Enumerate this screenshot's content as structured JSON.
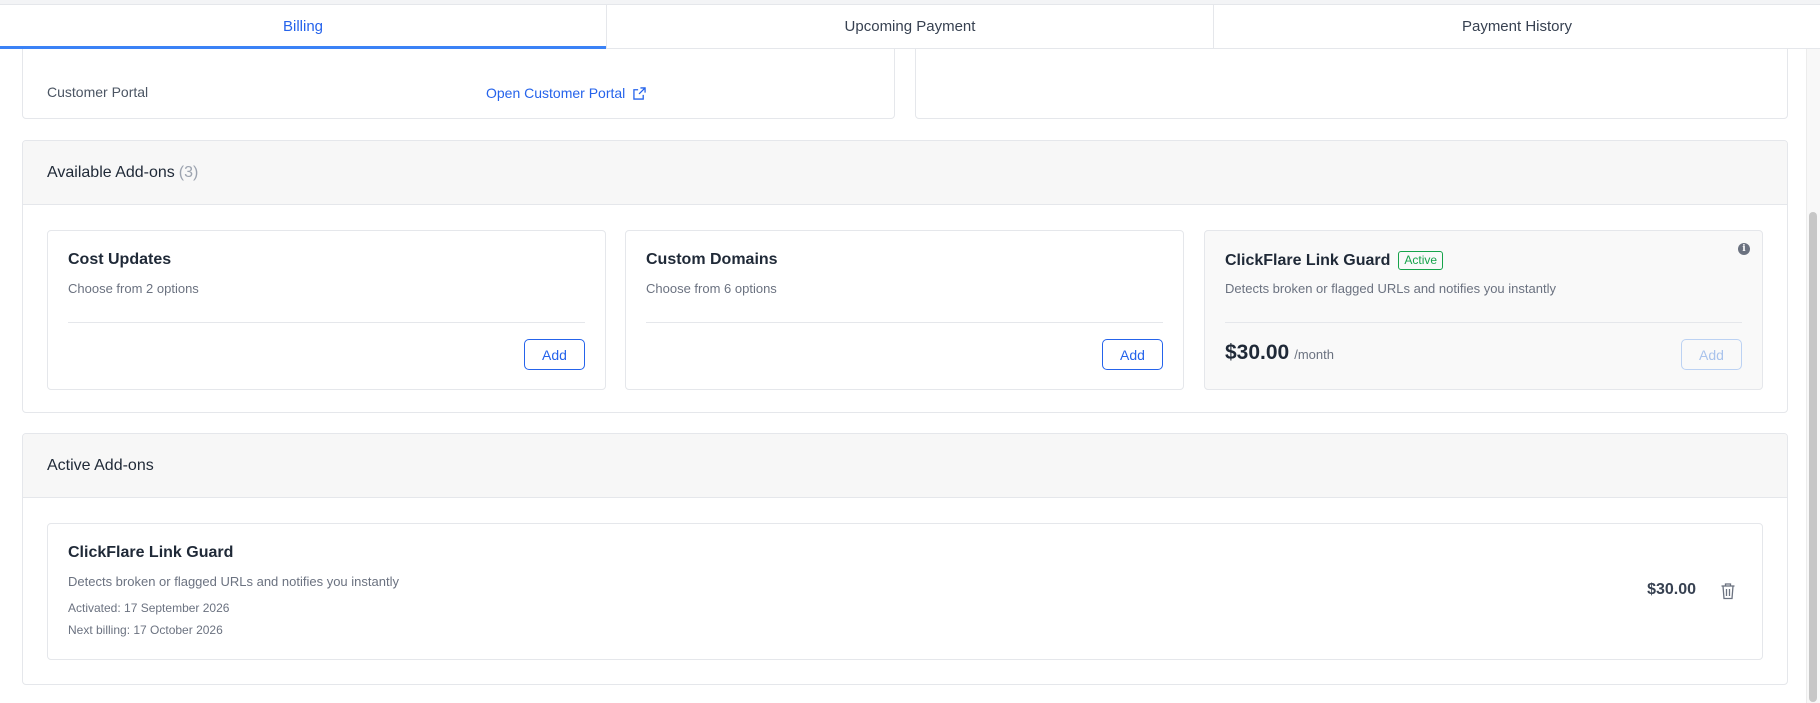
{
  "tabs": {
    "billing": "Billing",
    "upcoming": "Upcoming Payment",
    "history": "Payment History"
  },
  "portal": {
    "label": "Customer Portal",
    "link": "Open Customer Portal"
  },
  "available": {
    "title": "Available Add-ons",
    "count": "(3)",
    "items": [
      {
        "title": "Cost Updates",
        "desc": "Choose from 2 options",
        "button": "Add"
      },
      {
        "title": "Custom Domains",
        "desc": "Choose from 6 options",
        "button": "Add"
      },
      {
        "title": "ClickFlare Link Guard",
        "badge": "Active",
        "desc": "Detects broken or flagged URLs and notifies you instantly",
        "price": "$30.00",
        "period": "/month",
        "button": "Add"
      }
    ]
  },
  "active": {
    "title": "Active Add-ons",
    "item": {
      "title": "ClickFlare Link Guard",
      "desc": "Detects broken or flagged URLs and notifies you instantly",
      "activated": "Activated: 17 September 2026",
      "next_billing": "Next billing: 17 October 2026",
      "amount": "$30.00"
    }
  },
  "colors": {
    "accent": "#2563eb",
    "active_badge": "#16a34a"
  },
  "icons": [
    "external-link-icon",
    "info-icon",
    "trash-icon"
  ]
}
